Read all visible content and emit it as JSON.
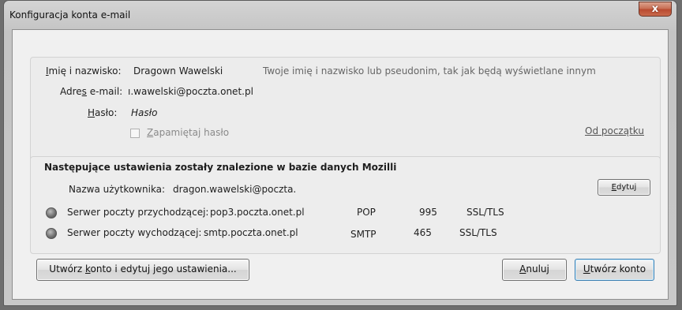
{
  "window": {
    "title": "Konfiguracja konta e-mail",
    "close_label": "x"
  },
  "account": {
    "name_label_ul": "I",
    "name_label_rest": "mię i nazwisko:",
    "name_value": "Dragown Wawelski",
    "name_hint": "Twoje imię i nazwisko lub pseudonim, tak jak będą wyświetlane innym",
    "email_label_pre": "Adre",
    "email_label_ul": "s",
    "email_label_post": " e-mail:",
    "email_value": "ı.wawelski@poczta.onet.pl",
    "password_label_ul": "H",
    "password_label_rest": "asło:",
    "password_placeholder": "Hasło",
    "remember_label_ul": "Z",
    "remember_label_rest": "apamiętaj hasło",
    "remember_checked": false,
    "reset_link": "Od początku"
  },
  "found_settings": {
    "heading": "Następujące ustawienia zostały znalezione w bazie danych Mozilli",
    "username_label": "Nazwa użytkownika:",
    "username_value": "dragon.wawelski@poczta.",
    "edit_button_ul": "E",
    "edit_button_rest": "dytuj",
    "servers": [
      {
        "label": "Serwer poczty przychodzącej:",
        "host": "pop3.poczta.onet.pl",
        "protocol": "POP",
        "port": "995",
        "security": "SSL/TLS"
      },
      {
        "label": "Serwer poczty wychodzącej:",
        "host": "smtp.poczta.onet.pl",
        "protocol": "SMTP",
        "port": "465",
        "security": "SSL/TLS"
      }
    ]
  },
  "buttons": {
    "advanced_pre": "Utwórz ",
    "advanced_ul": "k",
    "advanced_post": "onto i edytuj jego ustawienia...",
    "cancel_ul": "A",
    "cancel_rest": "nuluj",
    "create_ul": "U",
    "create_rest": "twórz konto"
  },
  "colors": {
    "client_bg": "#f0f0f0",
    "close_button": "#c86d52",
    "status_dot": "#6d6d6d"
  }
}
